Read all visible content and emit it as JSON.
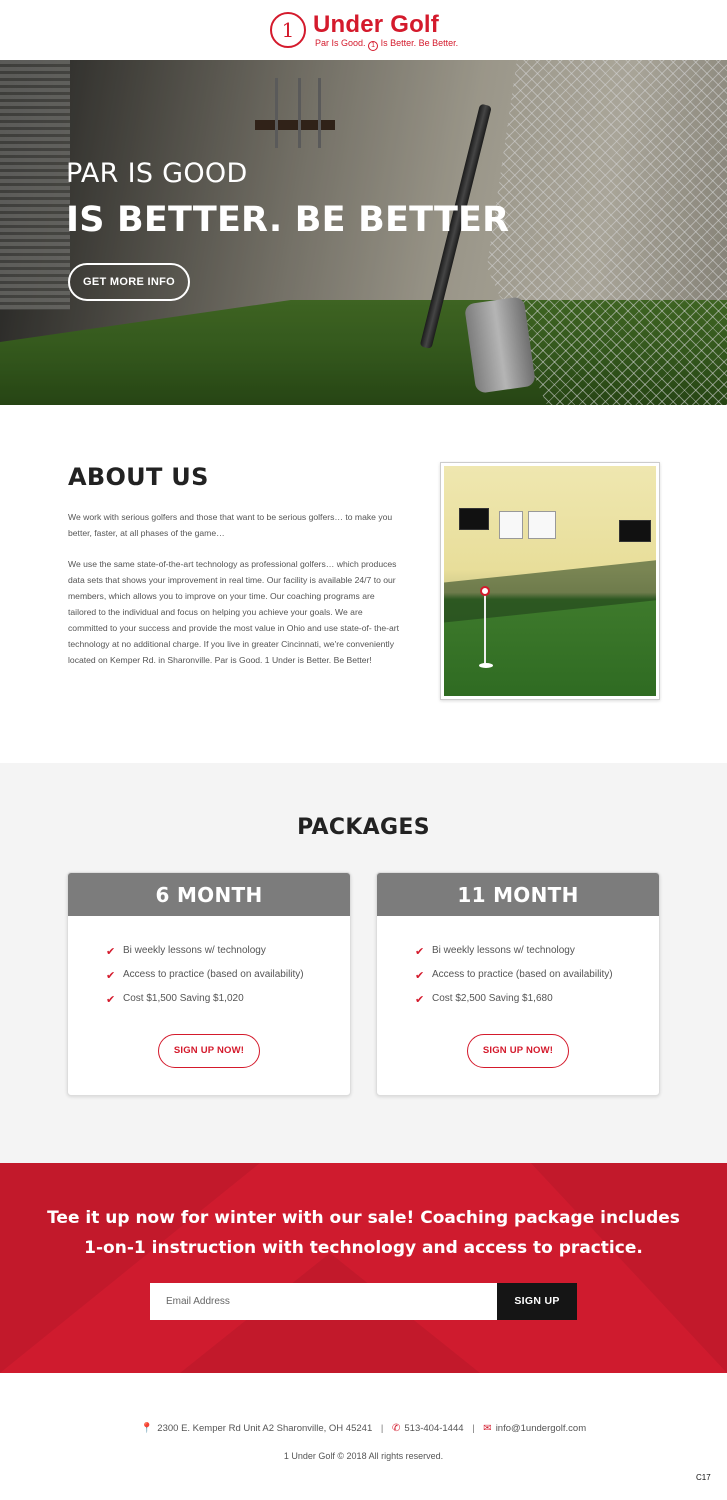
{
  "header": {
    "logo_number": "1",
    "logo_title": "Under Golf",
    "tagline_pre": "Par Is Good.",
    "tagline_num": "1",
    "tagline_post": "Is Better. Be Better."
  },
  "hero": {
    "line1": "PAR IS GOOD",
    "line2": "IS BETTER. BE BETTER",
    "button_label": "GET MORE INFO"
  },
  "about": {
    "title": "ABOUT US",
    "paragraph1": "We work with serious golfers and those that want to be serious golfers… to make you better, faster, at all phases of the game…",
    "paragraph2": "We use the same state-of-the-art technology as professional golfers… which produces data sets that shows your improvement in real time. Our facility is available 24/7 to our members, which allows you to improve on your time. Our coaching programs are tailored to the individual and focus on helping you achieve your goals. We are committed to your success and provide the most value in Ohio and use state-of- the-art technology at no additional charge. If you live in greater Cincinnati, we're conveniently located on Kemper Rd. in Sharonville. Par is Good. 1 Under is Better. Be Better!"
  },
  "packages": {
    "title": "PACKAGES",
    "items": [
      {
        "name": "6 MONTH",
        "features": [
          "Bi weekly lessons w/ technology",
          "Access to practice (based on availability)",
          "Cost $1,500 Saving $1,020"
        ],
        "button_label": "SIGN UP NOW!"
      },
      {
        "name": "11 MONTH",
        "features": [
          "Bi weekly lessons w/ technology",
          "Access to practice (based on availability)",
          "Cost $2,500 Saving $1,680"
        ],
        "button_label": "SIGN UP NOW!"
      }
    ]
  },
  "promo": {
    "line1": "Tee it up now for winter with our sale! Coaching package includes",
    "line2": "1-on-1 instruction with technology and access to practice.",
    "email_placeholder": "Email Address",
    "button_label": "SIGN UP"
  },
  "footer": {
    "address": "2300 E. Kemper Rd Unit A2 Sharonville, OH 45241",
    "phone": "513-404-1444",
    "email": "info@1undergolf.com",
    "copyright": "1 Under Golf © 2018 All rights reserved.",
    "corner_code": "C17"
  },
  "icons": {
    "check": "check-icon",
    "location": "map-marker-icon",
    "phone": "phone-icon",
    "email": "envelope-icon"
  },
  "colors": {
    "brand_red": "#d41a2c",
    "promo_red": "#cf1b2e",
    "package_header_gray": "#7c7c7c",
    "section_gray": "#f4f4f4",
    "dark_button": "#151515"
  }
}
